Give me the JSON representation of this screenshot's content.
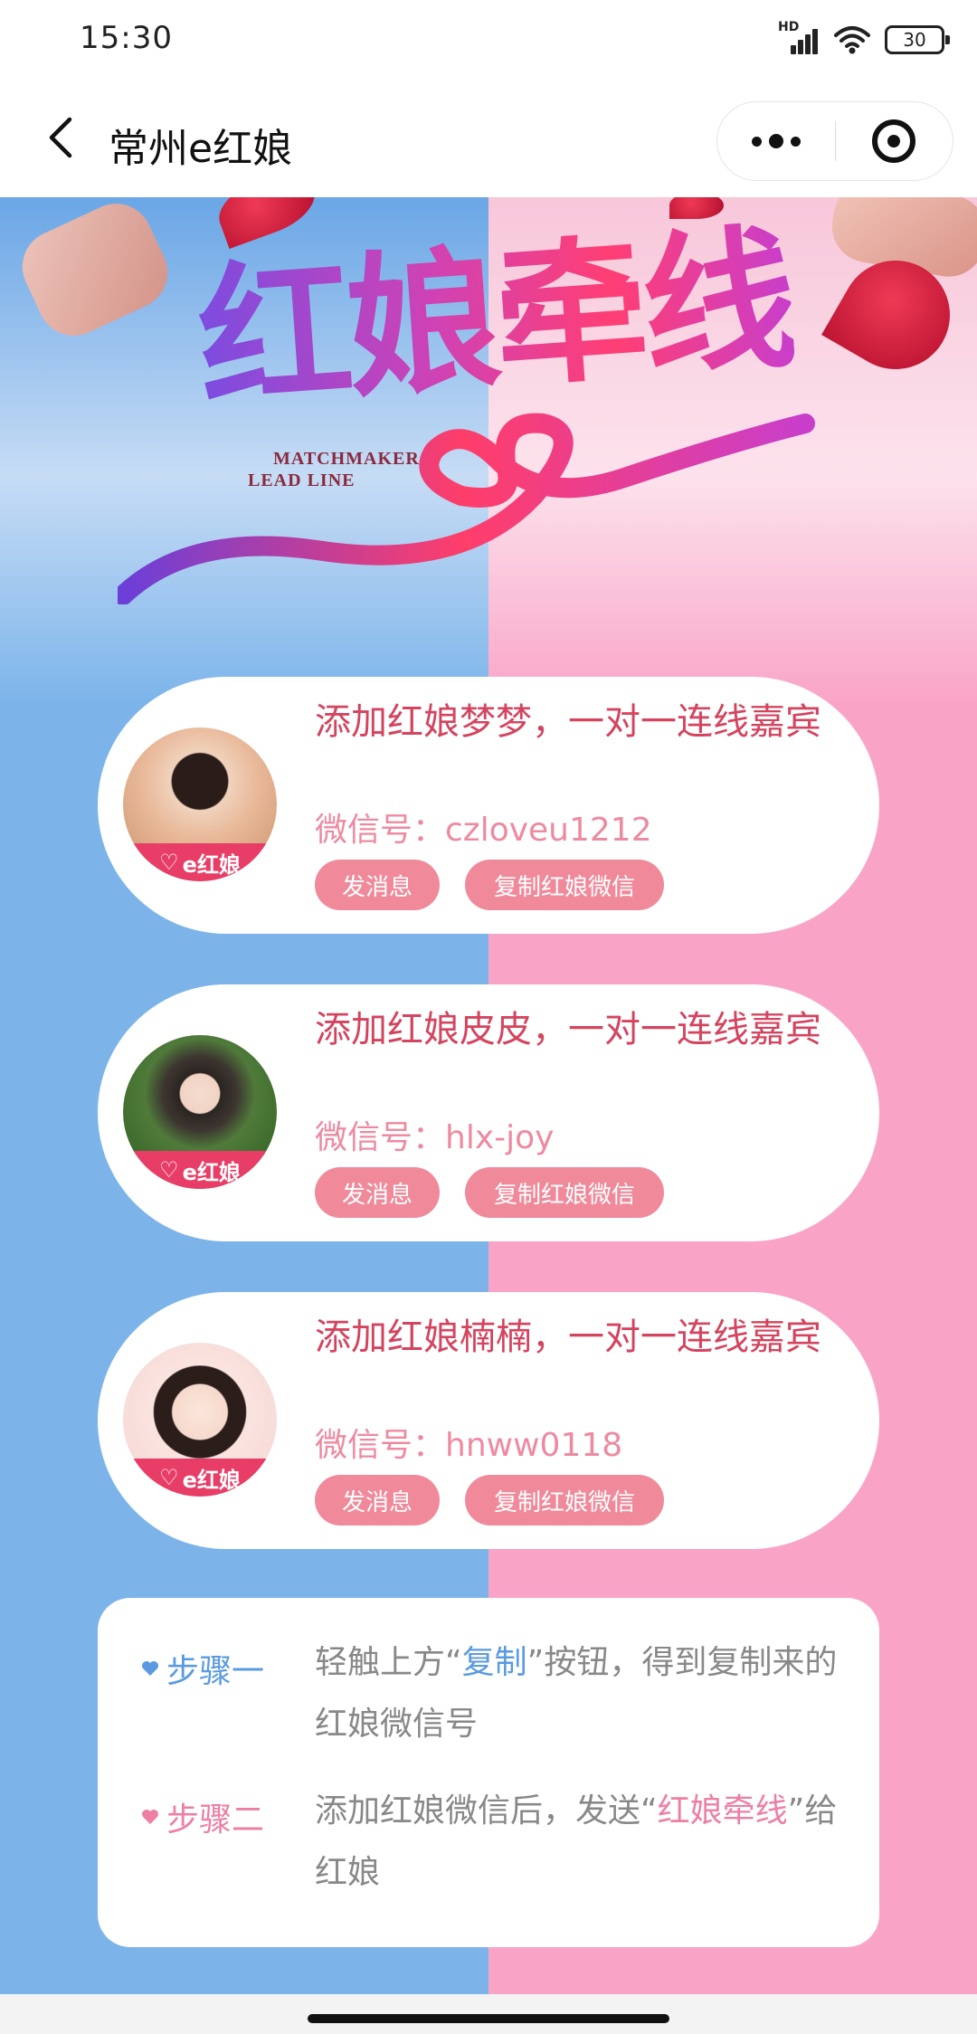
{
  "status_bar": {
    "time": "15:30",
    "network_badge": "HD",
    "battery": "30"
  },
  "nav": {
    "title": "常州e红娘",
    "back_icon": "chevron-left-icon",
    "more_icon": "more-dots-icon",
    "close_icon": "target-close-icon"
  },
  "banner": {
    "title": "红娘牵线",
    "subtitle_line1": "MATCHMAKER",
    "subtitle_line2": "LEAD LINE"
  },
  "matchmakers": [
    {
      "title": "添加红娘梦梦，一对一连线嘉宾",
      "wechat_label": "微信号：",
      "wechat_id": "czloveu1212",
      "message_label": "发消息",
      "copy_label": "复制红娘微信",
      "avatar_badge": "e红娘",
      "avatar_style": "photo-warm"
    },
    {
      "title": "添加红娘皮皮，一对一连线嘉宾",
      "wechat_label": "微信号：",
      "wechat_id": "hlx-joy",
      "message_label": "发消息",
      "copy_label": "复制红娘微信",
      "avatar_badge": "e红娘",
      "avatar_style": "photo-green"
    },
    {
      "title": "添加红娘楠楠，一对一连线嘉宾",
      "wechat_label": "微信号：",
      "wechat_id": "hnww0118",
      "message_label": "发消息",
      "copy_label": "复制红娘微信",
      "avatar_badge": "e红娘",
      "avatar_style": "cartoon"
    }
  ],
  "steps": [
    {
      "label": "步骤一",
      "text_before": "轻触上方“",
      "highlight": "复制",
      "text_after": "”按钮，得到复制来的红娘微信号",
      "color": "#5a9ae0"
    },
    {
      "label": "步骤二",
      "text_before": "添加红娘微信后，发送“",
      "highlight": "红娘牵线",
      "text_after": "”给红娘",
      "color": "#ee7fa4"
    }
  ],
  "colors": {
    "bg_blue": "#7cb4ea",
    "bg_pink": "#f9a4c7",
    "card_title": "#d4445f",
    "button": "#f08a9b",
    "badge": "#e83d66"
  }
}
